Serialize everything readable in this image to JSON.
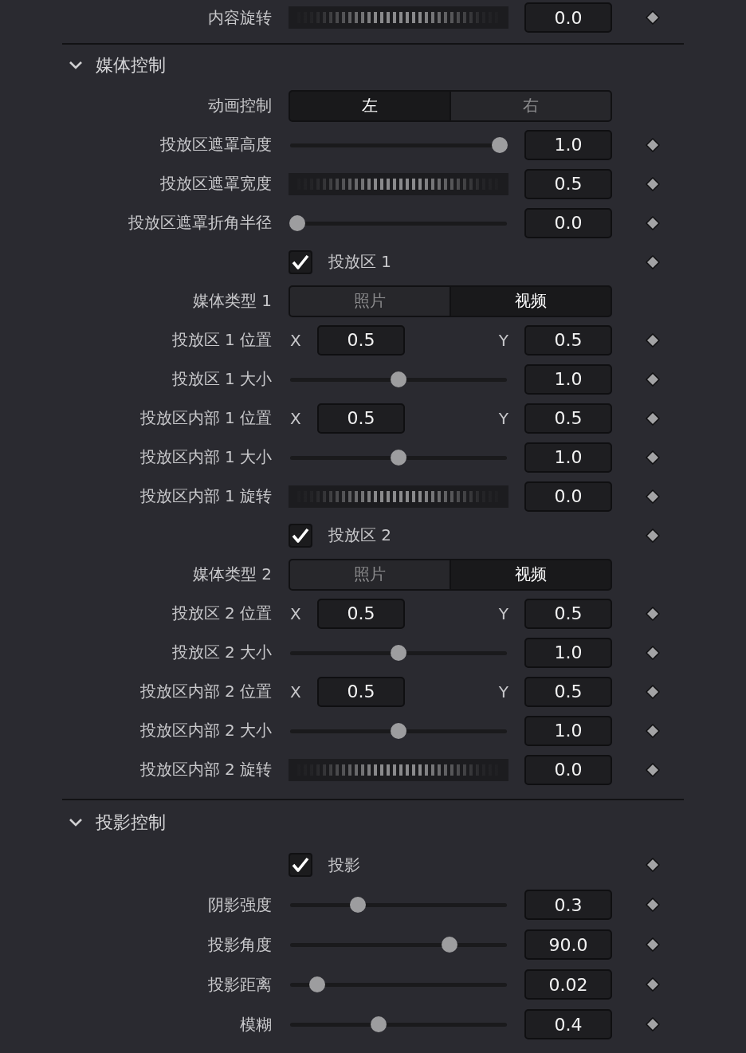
{
  "previous_section": {
    "rows": [
      {
        "kind": "jog",
        "label": "内容旋转",
        "value": "0.0"
      }
    ]
  },
  "sections": [
    {
      "title": "媒体控制",
      "expanded": true,
      "rows": [
        {
          "kind": "segmented",
          "label": "动画控制",
          "options": [
            {
              "label": "左",
              "selected": true
            },
            {
              "label": "右",
              "selected": false
            }
          ]
        },
        {
          "kind": "slider",
          "label": "投放区遮罩高度",
          "level": 1.0,
          "value": "1.0"
        },
        {
          "kind": "jog",
          "label": "投放区遮罩宽度",
          "value": "0.5"
        },
        {
          "kind": "slider",
          "label": "投放区遮罩折角半径",
          "level": 0,
          "value": "0.0"
        },
        {
          "kind": "checkbox",
          "label": "投放区 1",
          "checked": true
        },
        {
          "kind": "segmented",
          "label": "媒体类型 1",
          "options": [
            {
              "label": "照片",
              "selected": false
            },
            {
              "label": "视频",
              "selected": true
            }
          ]
        },
        {
          "kind": "xy",
          "label": "投放区 1 位置",
          "x_label": "X",
          "x_value": "0.5",
          "y_label": "Y",
          "y_value": "0.5"
        },
        {
          "kind": "slider",
          "label": "投放区 1 大小",
          "level": 0.5,
          "value": "1.0"
        },
        {
          "kind": "xy",
          "label": "投放区内部 1 位置",
          "x_label": "X",
          "x_value": "0.5",
          "y_label": "Y",
          "y_value": "0.5"
        },
        {
          "kind": "slider",
          "label": "投放区内部 1 大小",
          "level": 0.5,
          "value": "1.0"
        },
        {
          "kind": "jog",
          "label": "投放区内部 1 旋转",
          "value": "0.0"
        },
        {
          "kind": "checkbox",
          "label": "投放区 2",
          "checked": true
        },
        {
          "kind": "segmented",
          "label": "媒体类型 2",
          "options": [
            {
              "label": "照片",
              "selected": false
            },
            {
              "label": "视频",
              "selected": true
            }
          ]
        },
        {
          "kind": "xy",
          "label": "投放区 2 位置",
          "x_label": "X",
          "x_value": "0.5",
          "y_label": "Y",
          "y_value": "0.5"
        },
        {
          "kind": "slider",
          "label": "投放区 2 大小",
          "level": 0.5,
          "value": "1.0"
        },
        {
          "kind": "xy",
          "label": "投放区内部 2 位置",
          "x_label": "X",
          "x_value": "0.5",
          "y_label": "Y",
          "y_value": "0.5"
        },
        {
          "kind": "slider",
          "label": "投放区内部 2 大小",
          "level": 0.5,
          "value": "1.0"
        },
        {
          "kind": "jog",
          "label": "投放区内部 2 旋转",
          "value": "0.0"
        }
      ]
    },
    {
      "title": "投影控制",
      "expanded": true,
      "rows": [
        {
          "kind": "checkbox",
          "label": "投影",
          "checked": true
        },
        {
          "kind": "slider",
          "label": "阴影强度",
          "level": 0.3,
          "value": "0.3"
        },
        {
          "kind": "slider",
          "label": "投影角度",
          "level": 0.75,
          "value": "90.0"
        },
        {
          "kind": "slider",
          "label": "投影距离",
          "level": 0.1,
          "value": "0.02"
        },
        {
          "kind": "slider",
          "label": "模糊",
          "level": 0.4,
          "value": "0.4"
        }
      ]
    }
  ]
}
